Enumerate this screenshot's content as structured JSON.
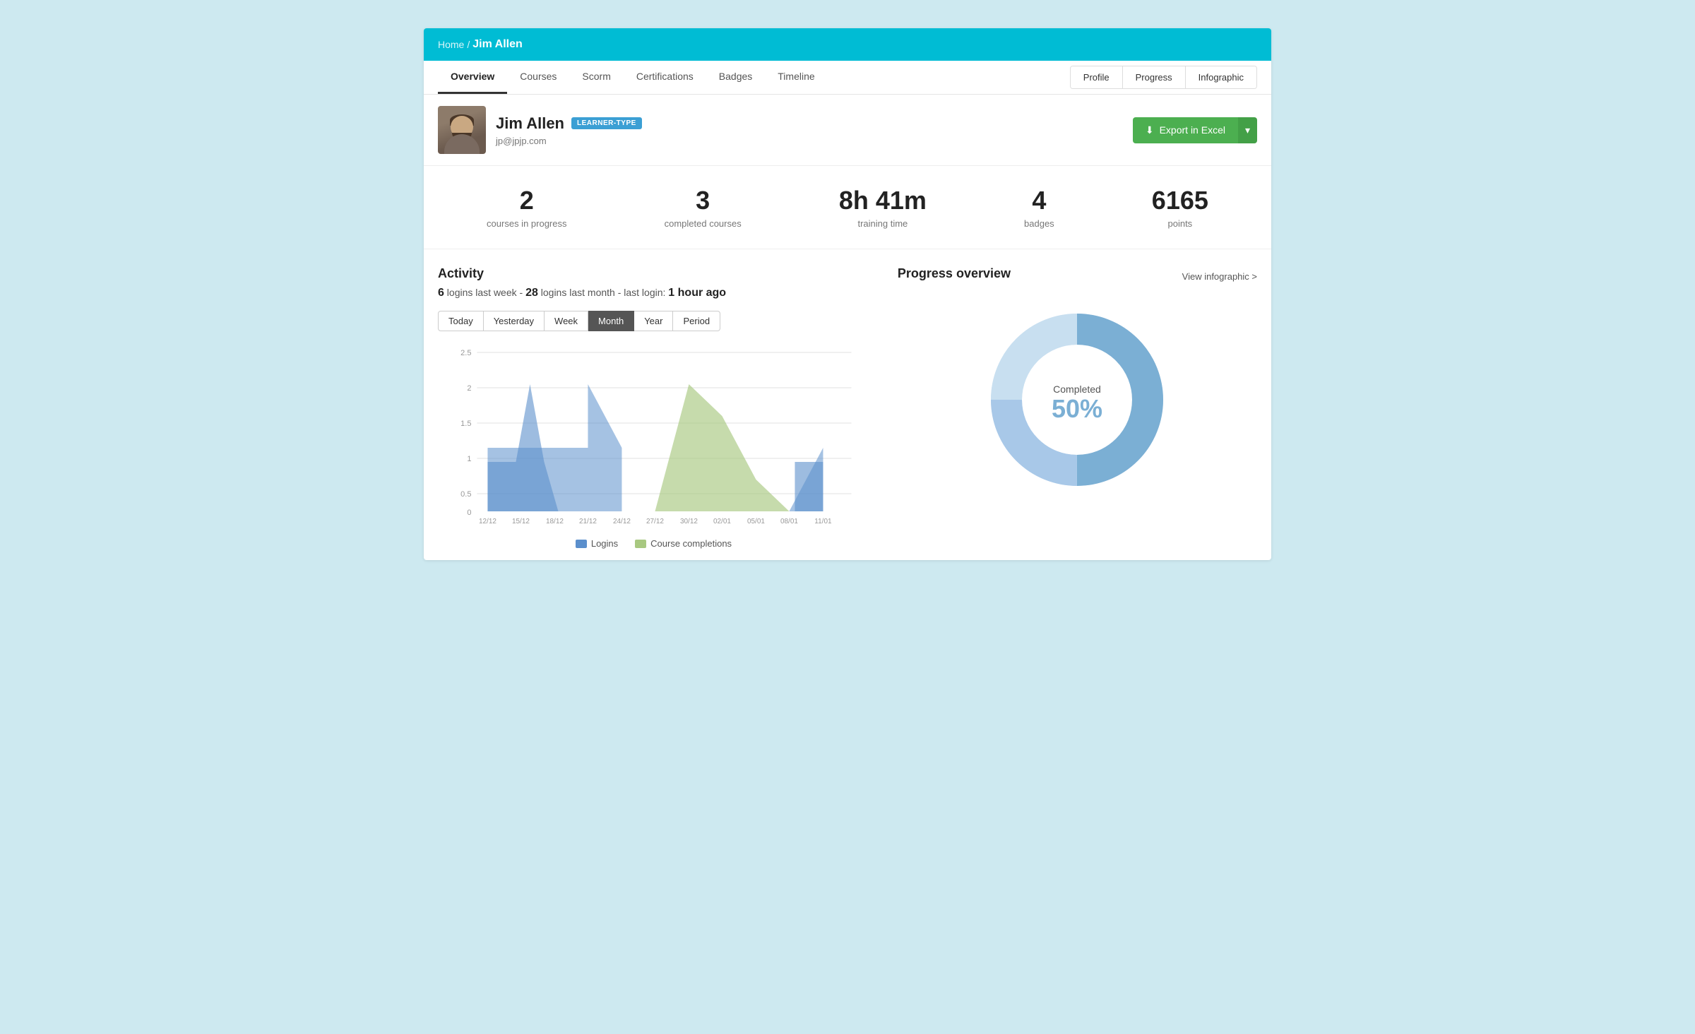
{
  "breadcrumb": {
    "home": "Home",
    "separator": "/",
    "current": "Jim Allen"
  },
  "nav": {
    "tabs": [
      {
        "id": "overview",
        "label": "Overview",
        "active": true
      },
      {
        "id": "courses",
        "label": "Courses",
        "active": false
      },
      {
        "id": "scorm",
        "label": "Scorm",
        "active": false
      },
      {
        "id": "certifications",
        "label": "Certifications",
        "active": false
      },
      {
        "id": "badges",
        "label": "Badges",
        "active": false
      },
      {
        "id": "timeline",
        "label": "Timeline",
        "active": false
      }
    ],
    "right_buttons": [
      {
        "id": "profile",
        "label": "Profile",
        "active": false
      },
      {
        "id": "progress",
        "label": "Progress",
        "active": false
      },
      {
        "id": "infographic",
        "label": "Infographic",
        "active": false
      }
    ]
  },
  "profile": {
    "name": "Jim Allen",
    "badge": "LEARNER-TYPE",
    "email": "jp@jpjp.com",
    "export_label": "Export in Excel",
    "export_arrow": "▾"
  },
  "stats": [
    {
      "value": "2",
      "label": "courses in progress"
    },
    {
      "value": "3",
      "label": "completed courses"
    },
    {
      "value": "8h 41m",
      "label": "training time"
    },
    {
      "value": "4",
      "label": "badges"
    },
    {
      "value": "6165",
      "label": "points"
    }
  ],
  "activity": {
    "title": "Activity",
    "summary_logins_week": "6",
    "summary_logins_month": "28",
    "summary_last_login": "1 hour ago",
    "time_filters": [
      {
        "id": "today",
        "label": "Today",
        "active": false
      },
      {
        "id": "yesterday",
        "label": "Yesterday",
        "active": false
      },
      {
        "id": "week",
        "label": "Week",
        "active": false
      },
      {
        "id": "month",
        "label": "Month",
        "active": true
      },
      {
        "id": "year",
        "label": "Year",
        "active": false
      },
      {
        "id": "period",
        "label": "Period",
        "active": false
      }
    ],
    "chart": {
      "x_labels": [
        "12/12",
        "15/12",
        "18/12",
        "21/12",
        "24/12",
        "27/12",
        "30/12",
        "02/01",
        "05/01",
        "08/01",
        "11/01"
      ],
      "y_labels": [
        "0",
        "0.5",
        "1",
        "1.5",
        "2",
        "2.5"
      ],
      "logins": [
        1,
        1,
        1,
        2,
        1,
        0,
        0,
        0,
        0,
        1,
        1
      ],
      "completions": [
        0,
        0,
        0,
        0,
        0,
        0,
        2,
        1.5,
        0.5,
        0,
        0
      ]
    },
    "legend": [
      {
        "id": "logins",
        "label": "Logins",
        "color": "#5b8fcc"
      },
      {
        "id": "completions",
        "label": "Course completions",
        "color": "#a8c880"
      }
    ]
  },
  "progress": {
    "title": "Progress overview",
    "view_link": "View infographic >",
    "completed_label": "Completed",
    "completed_pct": "50%",
    "donut": {
      "completed": 50,
      "in_progress": 25,
      "not_started": 25
    }
  }
}
